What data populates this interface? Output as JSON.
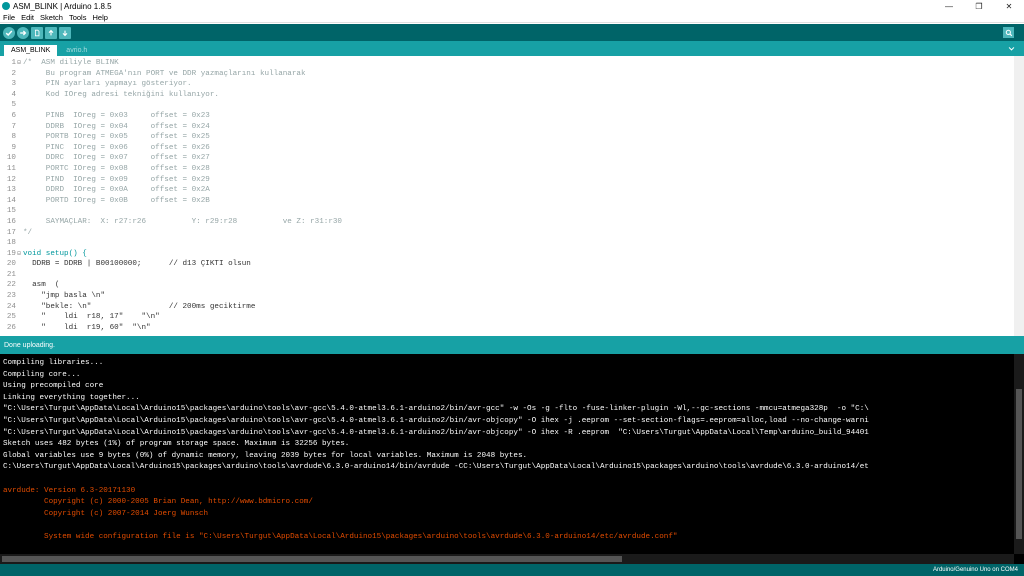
{
  "window": {
    "title": "ASM_BLINK | Arduino 1.8.5",
    "controls": [
      "—",
      "❐",
      "✕"
    ]
  },
  "menu": [
    "File",
    "Edit",
    "Sketch",
    "Tools",
    "Help"
  ],
  "toolbar": {
    "buttons": [
      "verify-icon",
      "upload-icon",
      "new-icon",
      "open-icon",
      "save-icon"
    ],
    "serial_monitor": "serial-monitor-icon"
  },
  "tabs": [
    {
      "label": "ASM_BLINK",
      "active": true
    },
    {
      "label": "avrio.h",
      "active": false
    }
  ],
  "editor": {
    "lines": [
      {
        "n": "1",
        "fold": "⊟",
        "text": "/*  ASM diliyle BLINK",
        "cls": "comment"
      },
      {
        "n": "2",
        "fold": "",
        "text": "     Bu program ATMEGA'nın PORT ve DDR yazmaçlarını kullanarak",
        "cls": "comment"
      },
      {
        "n": "3",
        "fold": "",
        "text": "     PIN ayarları yapmayı gösteriyor.",
        "cls": "comment"
      },
      {
        "n": "4",
        "fold": "",
        "text": "     Kod IOreg adresi tekniğini kullanıyor.",
        "cls": "comment"
      },
      {
        "n": "5",
        "fold": "",
        "text": "",
        "cls": "comment"
      },
      {
        "n": "6",
        "fold": "",
        "text": "     PINB  IOreg = 0x03     offset = 0x23",
        "cls": "comment"
      },
      {
        "n": "7",
        "fold": "",
        "text": "     DDRB  IOreg = 0x04     offset = 0x24",
        "cls": "comment"
      },
      {
        "n": "8",
        "fold": "",
        "text": "     PORTB IOreg = 0x05     offset = 0x25",
        "cls": "comment"
      },
      {
        "n": "9",
        "fold": "",
        "text": "     PINC  IOreg = 0x06     offset = 0x26",
        "cls": "comment"
      },
      {
        "n": "10",
        "fold": "",
        "text": "     DDRC  IOreg = 0x07     offset = 0x27",
        "cls": "comment"
      },
      {
        "n": "11",
        "fold": "",
        "text": "     PORTC IOreg = 0x08     offset = 0x28",
        "cls": "comment"
      },
      {
        "n": "12",
        "fold": "",
        "text": "     PIND  IOreg = 0x09     offset = 0x29",
        "cls": "comment"
      },
      {
        "n": "13",
        "fold": "",
        "text": "     DDRD  IOreg = 0x0A     offset = 0x2A",
        "cls": "comment"
      },
      {
        "n": "14",
        "fold": "",
        "text": "     PORTD IOreg = 0x0B     offset = 0x2B",
        "cls": "comment"
      },
      {
        "n": "15",
        "fold": "",
        "text": "",
        "cls": "comment"
      },
      {
        "n": "16",
        "fold": "",
        "text": "     SAYMAÇLAR:  X: r27:r26          Y: r29:r28          ve Z: r31:r30",
        "cls": "comment"
      },
      {
        "n": "17",
        "fold": "",
        "text": "*/",
        "cls": "comment"
      },
      {
        "n": "18",
        "fold": "",
        "text": "",
        "cls": ""
      },
      {
        "n": "19",
        "fold": "⊟",
        "text": "void setup() {",
        "cls": "kw"
      },
      {
        "n": "20",
        "fold": "",
        "text": "  DDRB = DDRB | B00100000;      // d13 ÇIKTI olsun",
        "cls": ""
      },
      {
        "n": "21",
        "fold": "",
        "text": "",
        "cls": ""
      },
      {
        "n": "22",
        "fold": "",
        "text": "  asm  (",
        "cls": ""
      },
      {
        "n": "23",
        "fold": "",
        "text": "    \"jmp basla \\n\"",
        "cls": ""
      },
      {
        "n": "24",
        "fold": "",
        "text": "    \"bekle: \\n\"                 // 200ms geciktirme",
        "cls": ""
      },
      {
        "n": "25",
        "fold": "",
        "text": "    \"    ldi  r18, 17\"    \"\\n\"",
        "cls": ""
      },
      {
        "n": "26",
        "fold": "",
        "text": "    \"    ldi  r19, 60\"  \"\\n\"",
        "cls": ""
      }
    ]
  },
  "status": {
    "message": "Done uploading."
  },
  "console": {
    "lines": [
      {
        "text": "Compiling libraries...",
        "err": false
      },
      {
        "text": "Compiling core...",
        "err": false
      },
      {
        "text": "Using precompiled core",
        "err": false
      },
      {
        "text": "Linking everything together...",
        "err": false
      },
      {
        "text": "\"C:\\Users\\Turgut\\AppData\\Local\\Arduino15\\packages\\arduino\\tools\\avr-gcc\\5.4.0-atmel3.6.1-arduino2/bin/avr-gcc\" -w -Os -g -flto -fuse-linker-plugin -Wl,--gc-sections -mmcu=atmega328p  -o \"C:\\",
        "err": false
      },
      {
        "text": "\"C:\\Users\\Turgut\\AppData\\Local\\Arduino15\\packages\\arduino\\tools\\avr-gcc\\5.4.0-atmel3.6.1-arduino2/bin/avr-objcopy\" -O ihex -j .eeprom --set-section-flags=.eeprom=alloc,load --no-change-warni",
        "err": false
      },
      {
        "text": "\"C:\\Users\\Turgut\\AppData\\Local\\Arduino15\\packages\\arduino\\tools\\avr-gcc\\5.4.0-atmel3.6.1-arduino2/bin/avr-objcopy\" -O ihex -R .eeprom  \"C:\\Users\\Turgut\\AppData\\Local\\Temp\\arduino_build_94401",
        "err": false
      },
      {
        "text": "Sketch uses 482 bytes (1%) of program storage space. Maximum is 32256 bytes.",
        "err": false
      },
      {
        "text": "Global variables use 9 bytes (0%) of dynamic memory, leaving 2039 bytes for local variables. Maximum is 2048 bytes.",
        "err": false
      },
      {
        "text": "C:\\Users\\Turgut\\AppData\\Local\\Arduino15\\packages\\arduino\\tools\\avrdude\\6.3.0-arduino14/bin/avrdude -CC:\\Users\\Turgut\\AppData\\Local\\Arduino15\\packages\\arduino\\tools\\avrdude\\6.3.0-arduino14/et",
        "err": false
      },
      {
        "text": "",
        "err": false
      },
      {
        "text": "avrdude: Version 6.3-20171130",
        "err": true
      },
      {
        "text": "         Copyright (c) 2000-2005 Brian Dean, http://www.bdmicro.com/",
        "err": true
      },
      {
        "text": "         Copyright (c) 2007-2014 Joerg Wunsch",
        "err": true
      },
      {
        "text": "",
        "err": true
      },
      {
        "text": "         System wide configuration file is \"C:\\Users\\Turgut\\AppData\\Local\\Arduino15\\packages\\arduino\\tools\\avrdude\\6.3.0-arduino14/etc/avrdude.conf\"",
        "err": true
      }
    ]
  },
  "board": "Arduino/Genuino Uno on COM4",
  "colors": {
    "toolbar": "#006468",
    "tabbar": "#17a1a5",
    "console_bg": "#000000",
    "error_text": "#e34c00"
  }
}
